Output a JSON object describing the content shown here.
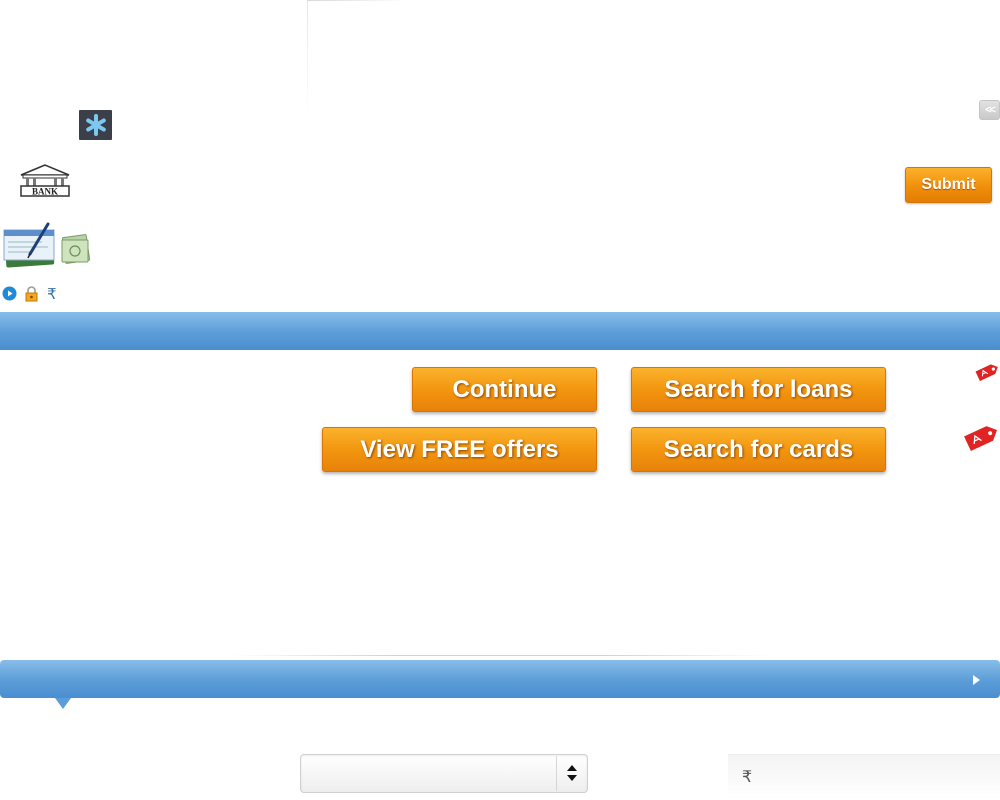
{
  "header": {
    "asterisk_symbol": "*",
    "collapse_label": "<<",
    "bank_logo_text": "BANK",
    "submit_label": "Submit",
    "rupee_symbol": "₹"
  },
  "actions": {
    "continue_label": "Continue",
    "search_loans_label": "Search for loans",
    "view_offers_label": "View FREE offers",
    "search_cards_label": "Search for cards"
  },
  "bottom": {
    "select_value": "",
    "rupee_symbol": "₹",
    "amount_value": ""
  },
  "colors": {
    "accent_orange": "#f3960f",
    "bar_blue": "#5b9dd8",
    "tag_red": "#e02424"
  },
  "icons": [
    "asterisk-icon",
    "bank-logo",
    "cheque-icon",
    "money-icon",
    "play-icon",
    "lock-icon",
    "rupee-icon",
    "tag-icon",
    "select-arrows-icon"
  ]
}
